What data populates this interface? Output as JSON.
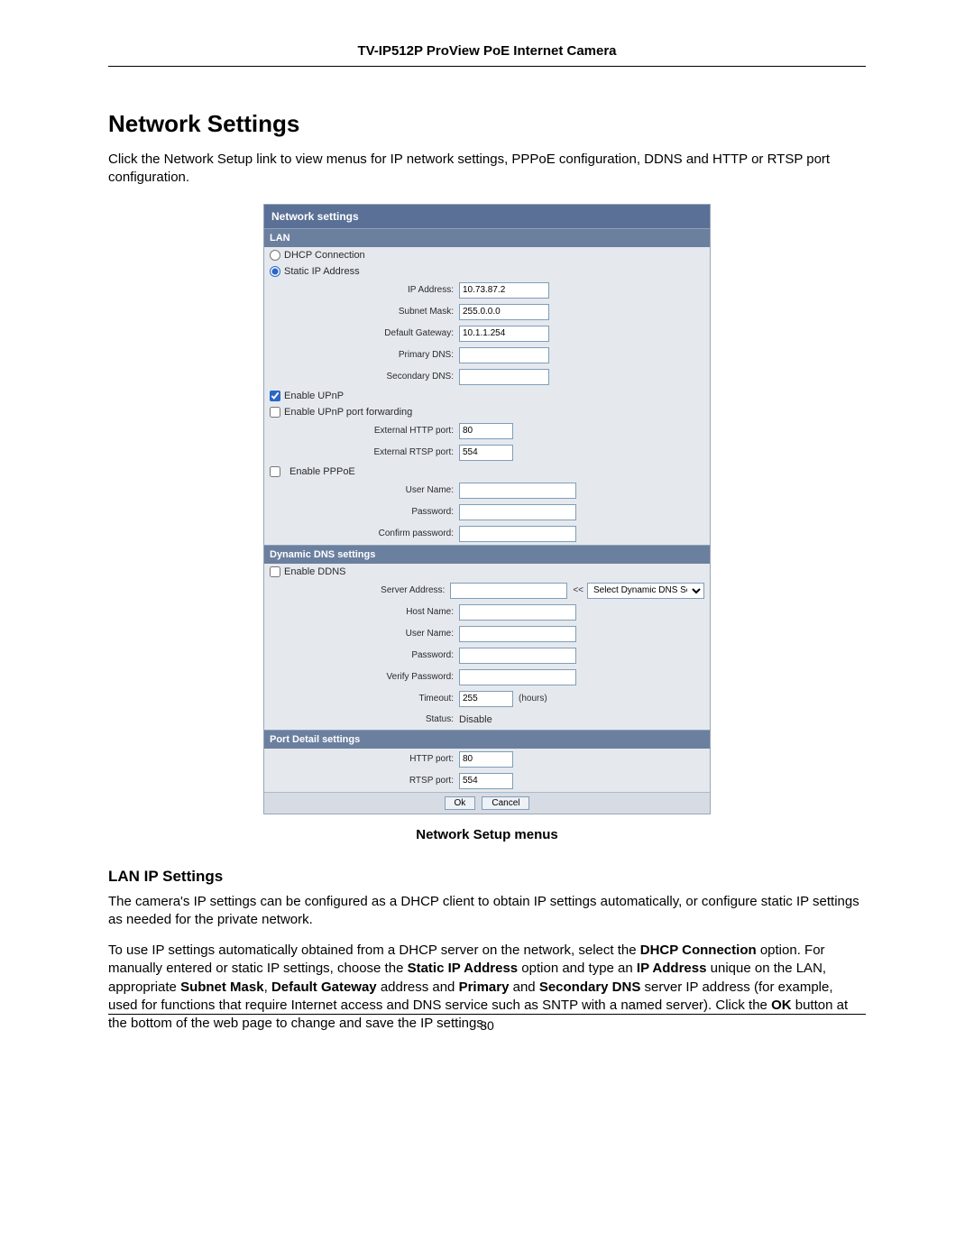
{
  "header": {
    "title": "TV-IP512P ProView PoE Internet Camera"
  },
  "section": {
    "title": "Network Settings",
    "intro": "Click the Network Setup link to view menus for IP network settings, PPPoE configuration, DDNS and HTTP or RTSP port configuration."
  },
  "panel": {
    "title": "Network settings",
    "lan": {
      "header": "LAN",
      "dhcp_label": "DHCP Connection",
      "static_label": "Static IP Address",
      "ip_label": "IP Address:",
      "ip_value": "10.73.87.2",
      "subnet_label": "Subnet Mask:",
      "subnet_value": "255.0.0.0",
      "gateway_label": "Default Gateway:",
      "gateway_value": "10.1.1.254",
      "pdns_label": "Primary DNS:",
      "pdns_value": "",
      "sdns_label": "Secondary DNS:",
      "sdns_value": "",
      "upnp_label": "Enable UPnP",
      "upnp_fwd_label": "Enable UPnP port forwarding",
      "ext_http_label": "External HTTP port:",
      "ext_http_value": "80",
      "ext_rtsp_label": "External RTSP port:",
      "ext_rtsp_value": "554",
      "pppoe_label": "Enable PPPoE",
      "user_label": "User Name:",
      "user_value": "",
      "pass_label": "Password:",
      "pass_value": "",
      "cpass_label": "Confirm password:",
      "cpass_value": ""
    },
    "ddns": {
      "header": "Dynamic DNS settings",
      "enable_label": "Enable DDNS",
      "server_label": "Server Address:",
      "server_value": "",
      "server_arrows": "<<",
      "server_select": "Select Dynamic DNS Server",
      "host_label": "Host Name:",
      "host_value": "",
      "user_label": "User Name:",
      "user_value": "",
      "pass_label": "Password:",
      "pass_value": "",
      "vpass_label": "Verify Password:",
      "vpass_value": "",
      "timeout_label": "Timeout:",
      "timeout_value": "255",
      "timeout_unit": "(hours)",
      "status_label": "Status:",
      "status_value": "Disable"
    },
    "port": {
      "header": "Port Detail settings",
      "http_label": "HTTP port:",
      "http_value": "80",
      "rtsp_label": "RTSP port:",
      "rtsp_value": "554"
    },
    "buttons": {
      "ok": "Ok",
      "cancel": "Cancel"
    }
  },
  "caption": "Network Setup menus",
  "lan_section": {
    "heading": "LAN IP Settings",
    "p1": "The camera's IP settings can be configured as a DHCP client to obtain IP settings automatically, or configure static IP settings as needed for the private network.",
    "p2_a": "To use IP settings automatically obtained from a DHCP server on the network, select the ",
    "p2_b1": "DHCP Connection",
    "p2_c": " option. For manually entered or static IP settings, choose the ",
    "p2_b2": "Static IP Address",
    "p2_d": " option and type an ",
    "p2_b3": "IP Address",
    "p2_e": " unique on the LAN, appropriate ",
    "p2_b4": "Subnet Mask",
    "p2_f": ", ",
    "p2_b5": "Default Gateway",
    "p2_g": " address and ",
    "p2_b6": "Primary",
    "p2_h": " and ",
    "p2_b7": "Secondary DNS",
    "p2_i": " server IP address (for example, used for functions that require Internet access and DNS service such as SNTP with a named server). Click the ",
    "p2_b8": "OK",
    "p2_j": " button at the bottom of the web page to change and save the IP settings."
  },
  "page_number": "30"
}
